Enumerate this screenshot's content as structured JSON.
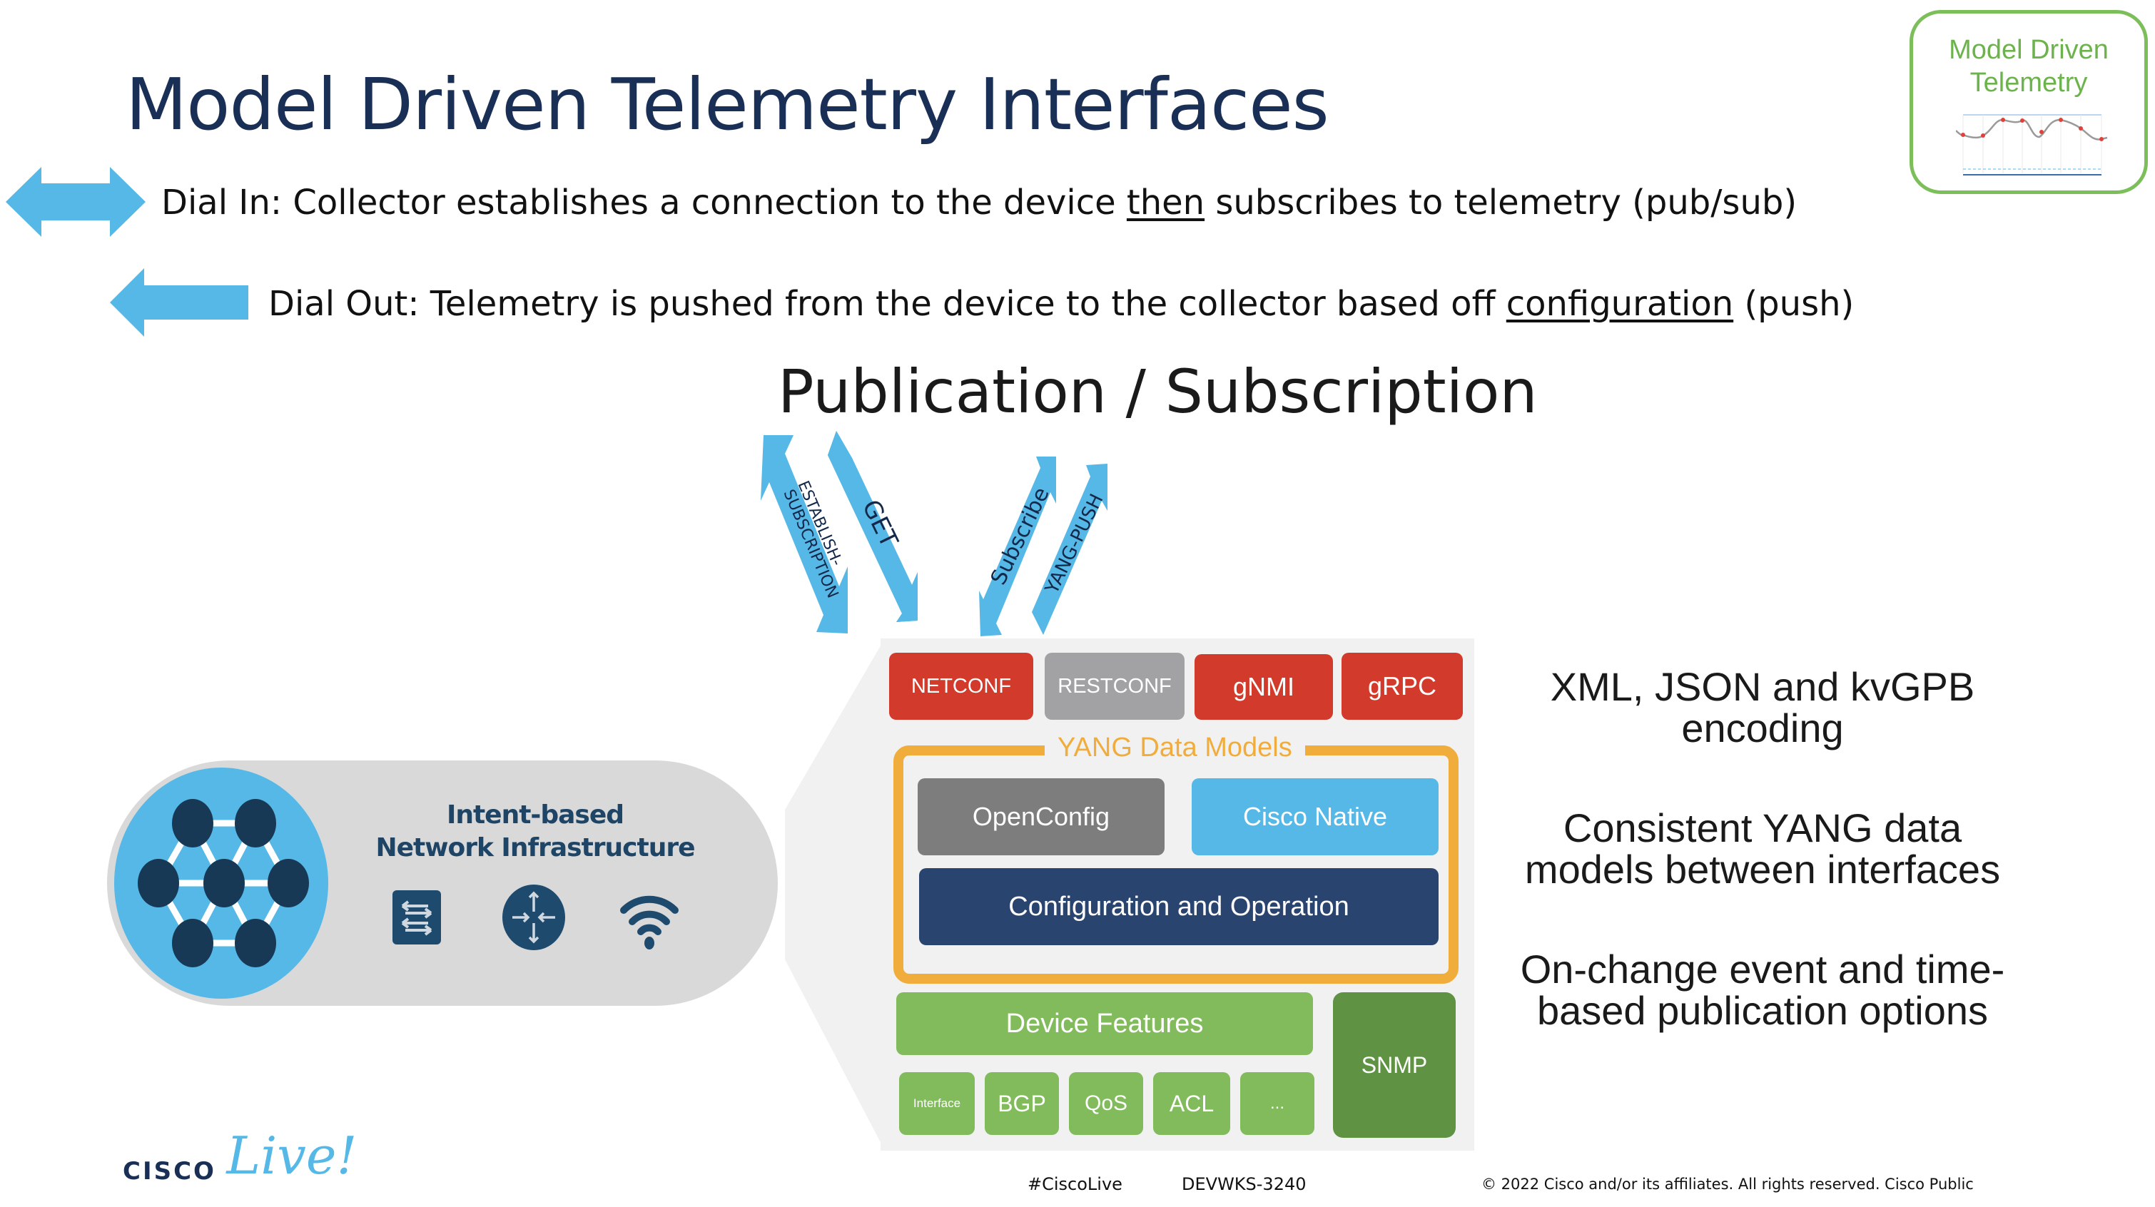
{
  "slide": {
    "title": "Model Driven Telemetry Interfaces",
    "badge": {
      "line1": "Model Driven",
      "line2": "Telemetry",
      "icon": "line-chart-icon"
    },
    "dial_in": {
      "icon": "double-arrow-icon",
      "prefix": "Dial In: Collector establishes a connection to the device ",
      "emphasis": "then",
      "suffix": " subscribes to telemetry (pub/sub)"
    },
    "dial_out": {
      "icon": "left-arrow-icon",
      "prefix": "Dial Out: Telemetry is pushed from the device to the collector based off ",
      "emphasis": "configuration",
      "suffix": " (push)"
    },
    "pubsub_heading": "Publication / Subscription",
    "flow_arrows": [
      {
        "label_line1": "ESTABLISH-",
        "label_line2": "SUBSCRIPTION",
        "direction": "bidirectional"
      },
      {
        "label": "GET",
        "direction": "down"
      },
      {
        "label": "Subscribe",
        "direction": "bidirectional"
      },
      {
        "label": "YANG-PUSH",
        "direction": "up"
      }
    ],
    "infrastructure": {
      "line1": "Intent-based",
      "line2": "Network Infrastructure",
      "icons": [
        "mesh-network-icon",
        "switch-icon",
        "router-icon",
        "wifi-icon"
      ]
    },
    "stack": {
      "interfaces": [
        {
          "label": "NETCONF",
          "color": "#d23a2c"
        },
        {
          "label": "RESTCONF",
          "color": "#a2a2a4"
        },
        {
          "label": "gNMI",
          "color": "#d23a2c"
        },
        {
          "label": "gRPC",
          "color": "#d23a2c"
        }
      ],
      "yang_title": "YANG Data Models",
      "openconfig": "OpenConfig",
      "cisco_native": "Cisco Native",
      "config_op": "Configuration and Operation",
      "device_features": "Device Features",
      "features": [
        "Interface",
        "BGP",
        "QoS",
        "ACL",
        "..."
      ],
      "snmp": "SNMP"
    },
    "benefits": [
      {
        "line1": "XML, JSON and  kvGPB",
        "line2": "encoding"
      },
      {
        "line1": "Consistent YANG data",
        "line2": "models between interfaces"
      },
      {
        "line1": "On-change event and time-",
        "line2": "based publication options"
      }
    ],
    "footer": {
      "logo_cisco": "CISCO",
      "logo_live": "Live!",
      "hashtag": "#CiscoLive",
      "session": "DEVWKS-3240",
      "copyright": "© 2022  Cisco and/or its affiliates. All rights reserved.   Cisco Public"
    },
    "colors": {
      "accent_blue": "#56b8e6",
      "title_navy": "#1a2f55",
      "red": "#d23a2c",
      "orange": "#f0ad3c",
      "green": "#82bb5c",
      "dark_green": "#5f9343",
      "navy_box": "#2a4470"
    }
  }
}
